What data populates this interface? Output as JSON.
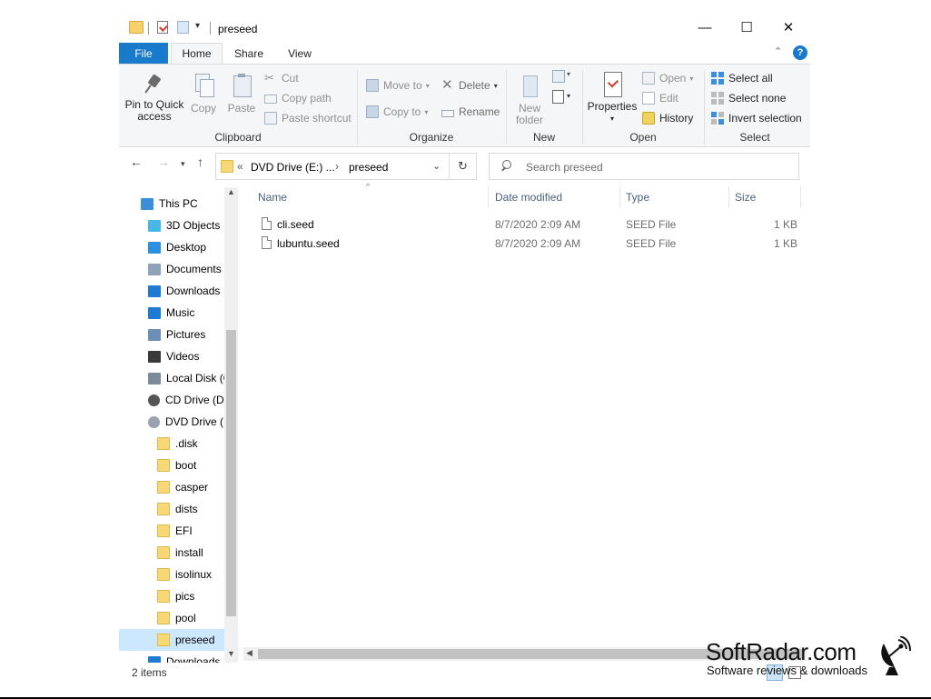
{
  "title_bar": {
    "title": "preseed",
    "minimize": "—",
    "maximize": "☐",
    "close": "✕"
  },
  "tabs": [
    {
      "label": "File"
    },
    {
      "label": "Home"
    },
    {
      "label": "Share"
    },
    {
      "label": "View"
    }
  ],
  "ribbon": {
    "clipboard": {
      "label": "Clipboard",
      "pin_line1": "Pin to Quick",
      "pin_line2": "access",
      "copy": "Copy",
      "paste": "Paste",
      "cut": "Cut",
      "copy_path": "Copy path",
      "paste_shortcut": "Paste shortcut"
    },
    "organize": {
      "label": "Organize",
      "move_to": "Move to",
      "copy_to": "Copy to",
      "delete": "Delete",
      "rename": "Rename"
    },
    "new": {
      "label": "New",
      "new_folder_line1": "New",
      "new_folder_line2": "folder"
    },
    "open": {
      "label": "Open",
      "properties": "Properties",
      "open": "Open",
      "edit": "Edit",
      "history": "History"
    },
    "select": {
      "label": "Select",
      "select_all": "Select all",
      "select_none": "Select none",
      "invert": "Invert selection"
    }
  },
  "address": {
    "prefix": "«",
    "segment1": "DVD Drive (E:) ...",
    "sep": "›",
    "segment2": "preseed",
    "search_placeholder": "Search preseed"
  },
  "tree": [
    {
      "label": "This PC",
      "icon": "pc-icon"
    },
    {
      "label": "3D Objects",
      "icon": "cube-icon"
    },
    {
      "label": "Desktop",
      "icon": "desktop-icon"
    },
    {
      "label": "Documents",
      "icon": "documents-icon"
    },
    {
      "label": "Downloads",
      "icon": "download-icon"
    },
    {
      "label": "Music",
      "icon": "music-icon"
    },
    {
      "label": "Pictures",
      "icon": "pictures-icon"
    },
    {
      "label": "Videos",
      "icon": "videos-icon"
    },
    {
      "label": "Local Disk (C:)",
      "icon": "disk-icon"
    },
    {
      "label": "CD Drive (D:)",
      "icon": "cd-icon"
    },
    {
      "label": "DVD Drive (E:)",
      "icon": "dvd-icon"
    },
    {
      "label": ".disk",
      "icon": "folder-icon"
    },
    {
      "label": "boot",
      "icon": "folder-icon"
    },
    {
      "label": "casper",
      "icon": "folder-icon"
    },
    {
      "label": "dists",
      "icon": "folder-icon"
    },
    {
      "label": "EFI",
      "icon": "folder-icon"
    },
    {
      "label": "install",
      "icon": "folder-icon"
    },
    {
      "label": "isolinux",
      "icon": "folder-icon"
    },
    {
      "label": "pics",
      "icon": "folder-icon"
    },
    {
      "label": "pool",
      "icon": "folder-icon"
    },
    {
      "label": "preseed",
      "icon": "folder-icon"
    },
    {
      "label": "Downloads",
      "icon": "download-icon"
    }
  ],
  "columns": {
    "name": "Name",
    "date": "Date modified",
    "type": "Type",
    "size": "Size"
  },
  "files": [
    {
      "name": "cli.seed",
      "date": "8/7/2020 2:09 AM",
      "type": "SEED File",
      "size": "1 KB"
    },
    {
      "name": "lubuntu.seed",
      "date": "8/7/2020 2:09 AM",
      "type": "SEED File",
      "size": "1 KB"
    }
  ],
  "status": {
    "items": "2 items"
  },
  "watermark": {
    "title": "SoftRadar.com",
    "subtitle": "Software reviews & downloads"
  },
  "colors": {
    "accent": "#1979ca",
    "selected": "#cce8ff",
    "folder": "#f8d775"
  }
}
